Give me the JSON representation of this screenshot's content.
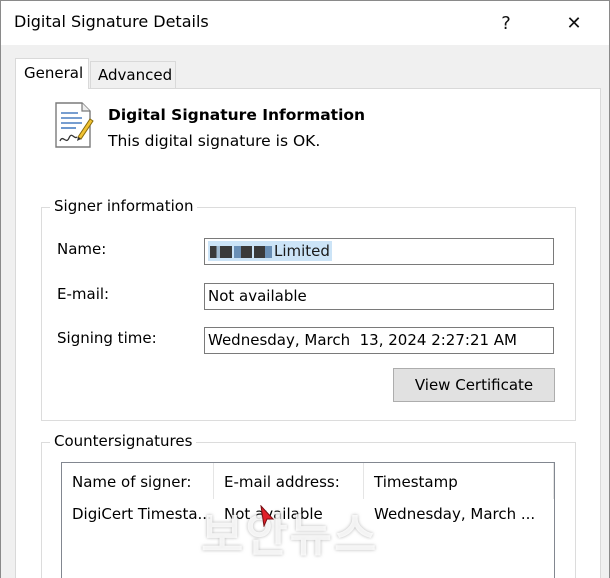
{
  "window": {
    "title": "Digital Signature Details",
    "help_label": "?",
    "close_label": "✕"
  },
  "tabs": [
    {
      "label": "General",
      "active": true
    },
    {
      "label": "Advanced",
      "active": false
    }
  ],
  "info": {
    "icon": "signed-document-icon",
    "heading": "Digital Signature Information",
    "status": "This digital signature is OK."
  },
  "signer": {
    "legend": "Signer information",
    "name_label": "Name:",
    "name_value": "Limited",
    "email_label": "E-mail:",
    "email_value": "Not available",
    "time_label": "Signing time:",
    "time_value": "Wednesday, March  13, 2024 2:27:21 AM",
    "view_cert_label": "View Certificate"
  },
  "countersignatures": {
    "legend": "Countersignatures",
    "columns": [
      "Name of signer:",
      "E-mail address:",
      "Timestamp"
    ],
    "rows": [
      [
        "DigiCert Timesta...",
        "Not available",
        "Wednesday, March ..."
      ]
    ]
  },
  "watermark": "보안뉴스",
  "colors": {
    "selection": "#cce4f7",
    "accent": "#0078d7"
  }
}
